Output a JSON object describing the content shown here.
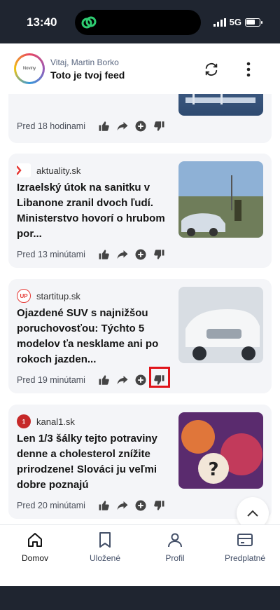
{
  "status": {
    "time": "13:40",
    "network": "5G"
  },
  "header": {
    "logo_text": "Noviny",
    "greeting": "Vitaj, Martin Borko",
    "title": "Toto je tvoj feed"
  },
  "cards": [
    {
      "source": "",
      "headline": "",
      "time": "Pred 18 hodinami"
    },
    {
      "source": "aktuality.sk",
      "source_logo_text": "a",
      "headline": "Izraelský útok na sanitku v Libanone zranil dvoch ľudí. Ministerstvo hovorí o hrubom por...",
      "time": "Pred 13 minútami"
    },
    {
      "source": "startitup.sk",
      "source_logo_text": "UP",
      "headline": "Ojazdené SUV s najnižšou poruchovosťou: Týchto 5 modelov ťa nesklame ani po rokoch jazden...",
      "time": "Pred 19 minútami"
    },
    {
      "source": "kanal1.sk",
      "source_logo_text": "1",
      "headline": "Len 1/3 šálky tejto potraviny denne a cholesterol znížite prirodzene! Slováci ju veľmi dobre poznajú",
      "time": "Pred 20 minútami"
    }
  ],
  "nav": [
    {
      "label": "Domov",
      "icon": "home-icon"
    },
    {
      "label": "Uložené",
      "icon": "bookmark-icon"
    },
    {
      "label": "Profil",
      "icon": "person-icon"
    },
    {
      "label": "Predplatné",
      "icon": "card-icon"
    }
  ],
  "colors": {
    "accent": "#5a6780",
    "highlight": "#e0141a",
    "card_bg": "#f4f5f8"
  }
}
